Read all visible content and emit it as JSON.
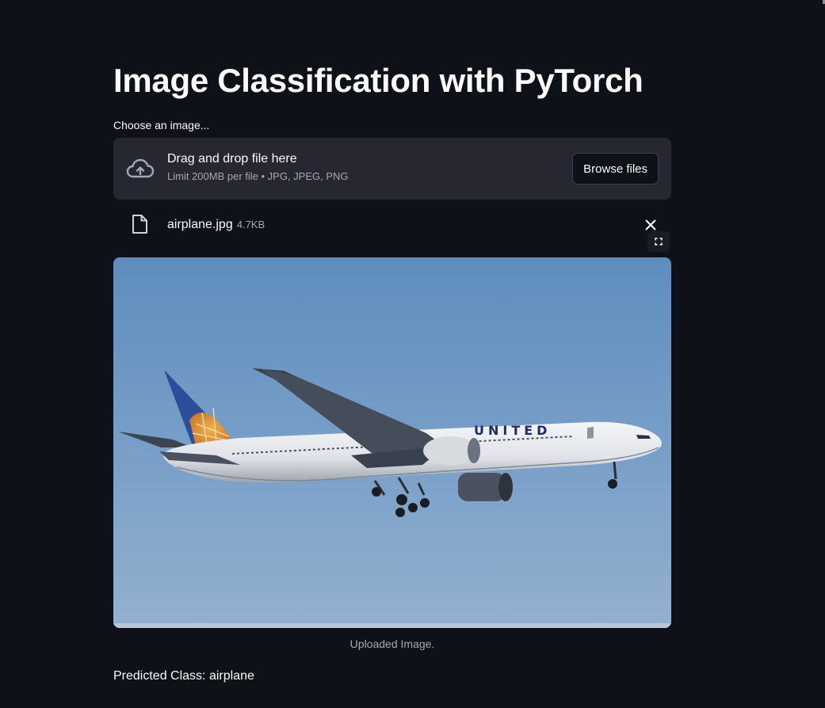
{
  "page": {
    "title": "Image Classification with PyTorch",
    "background": "#0e1117",
    "text_color": "#fafafa",
    "muted_color": "#a3a8b8"
  },
  "uploader": {
    "label": "Choose an image...",
    "drop_text": "Drag and drop file here",
    "limit_text": "Limit 200MB per file • JPG, JPEG, PNG",
    "browse_label": "Browse files",
    "icon": "cloud-upload-icon",
    "surface_color": "#262730"
  },
  "file": {
    "name": "airplane.jpg",
    "size": "4.7KB",
    "icon": "file-icon",
    "remove_icon": "close-icon"
  },
  "image": {
    "fullscreen_icon": "fullscreen-icon",
    "caption": "Uploaded Image.",
    "livery_text": "UNITED"
  },
  "result": {
    "text": "Predicted Class: airplane"
  }
}
